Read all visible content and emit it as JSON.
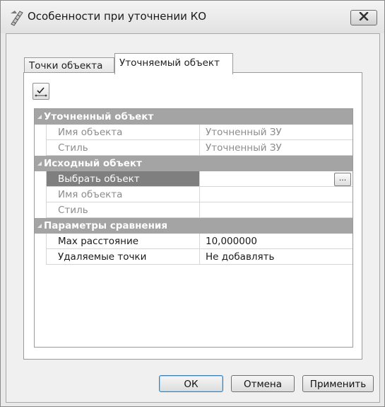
{
  "window": {
    "title": "Особенности при уточнении КО",
    "app_icon": "cadastral-ruler-icon",
    "close_icon": "close-x-icon"
  },
  "tabs": [
    {
      "label": "Точки объекта",
      "active": false
    },
    {
      "label": "Уточняемый объект",
      "active": true
    }
  ],
  "toolbar": {
    "icon": "checkmark-measure-icon"
  },
  "property_grid": {
    "groups": [
      {
        "title": "Уточненный объект",
        "rows": [
          {
            "name": "Имя объекта",
            "value": "Уточненный ЗУ"
          },
          {
            "name": "Стиль",
            "value": "Уточненный ЗУ"
          }
        ]
      },
      {
        "title": "Исходный объект",
        "rows": [
          {
            "name": "Выбрать объект",
            "value": "",
            "ellipsis": "..."
          },
          {
            "name": "Имя объекта",
            "value": ""
          },
          {
            "name": "Стиль",
            "value": ""
          }
        ]
      },
      {
        "title": "Параметры сравнения",
        "rows": [
          {
            "name": "Max расстояние",
            "value": "10,000000"
          },
          {
            "name": "Удаляемые точки",
            "value": "Не добавлять"
          }
        ]
      }
    ]
  },
  "buttons": {
    "ok": "ОК",
    "cancel": "Отмена",
    "apply": "Применить"
  },
  "colors": {
    "group_header_bg": "#a4a4a4",
    "selected_row_bg": "#7f7f7f",
    "default_button_border": "#3c7fb1"
  }
}
